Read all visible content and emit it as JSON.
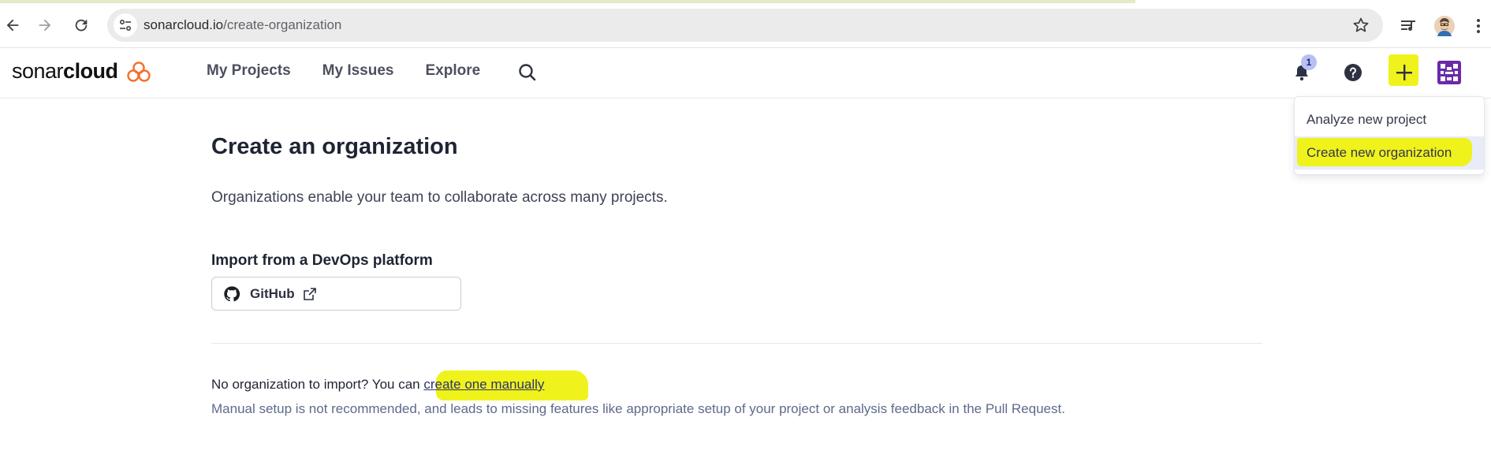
{
  "browser": {
    "url_host": "sonarcloud.io",
    "url_path": "/create-organization"
  },
  "header": {
    "logo_regular": "sonar",
    "logo_bold": "cloud",
    "nav": [
      "My Projects",
      "My Issues",
      "Explore"
    ],
    "notification_count": "1"
  },
  "dropdown": {
    "items": [
      "Analyze new project",
      "Create new organization"
    ]
  },
  "main": {
    "title": "Create an organization",
    "subtitle": "Organizations enable your team to collaborate across many projects.",
    "import_heading": "Import from a DevOps platform",
    "github_label": "GitHub",
    "no_org_text": "No organization to import? You can ",
    "manual_link": "create one manually",
    "manual_note": "Manual setup is not recommended, and leads to missing features like appropriate setup of your project or analysis feedback in the Pull Request."
  },
  "colors": {
    "highlight": "#f0f21c",
    "brand_orange": "#f3702a",
    "link": "#2d3470"
  }
}
